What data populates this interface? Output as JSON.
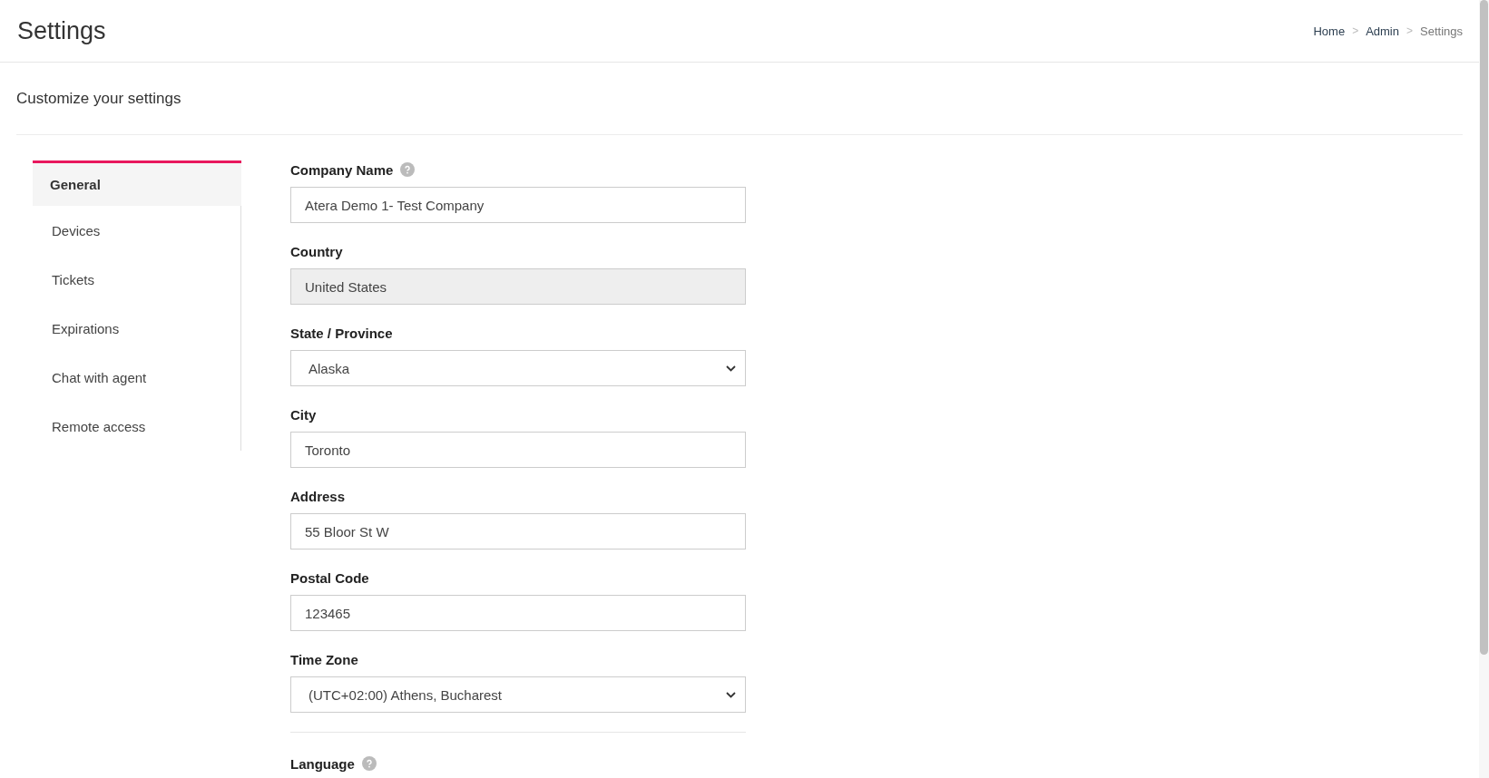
{
  "header": {
    "title": "Settings",
    "breadcrumbs": [
      {
        "label": "Home",
        "current": false
      },
      {
        "label": "Admin",
        "current": false
      },
      {
        "label": "Settings",
        "current": true
      }
    ],
    "separator": ">"
  },
  "subtitle": "Customize your settings",
  "sidebar": {
    "items": [
      {
        "label": "General",
        "selected": true
      },
      {
        "label": "Devices",
        "selected": false
      },
      {
        "label": "Tickets",
        "selected": false
      },
      {
        "label": "Expirations",
        "selected": false
      },
      {
        "label": "Chat with agent",
        "selected": false
      },
      {
        "label": "Remote access",
        "selected": false
      }
    ]
  },
  "form": {
    "fields": [
      {
        "label": "Company Name",
        "kind": "text",
        "value": "Atera Demo 1- Test Company",
        "help": true,
        "disabled": false
      },
      {
        "label": "Country",
        "kind": "text",
        "value": "United States",
        "help": false,
        "disabled": true
      },
      {
        "label": "State / Province",
        "kind": "select",
        "value": "Alaska",
        "help": false,
        "disabled": false
      },
      {
        "label": "City",
        "kind": "text",
        "value": "Toronto",
        "help": false,
        "disabled": false
      },
      {
        "label": "Address",
        "kind": "text",
        "value": "55 Bloor St W",
        "help": false,
        "disabled": false
      },
      {
        "label": "Postal Code",
        "kind": "text",
        "value": "123465",
        "help": false,
        "disabled": false
      },
      {
        "label": "Time Zone",
        "kind": "select",
        "value": "(UTC+02:00) Athens, Bucharest",
        "help": false,
        "disabled": false
      }
    ],
    "language": {
      "label": "Language",
      "help": true
    }
  }
}
